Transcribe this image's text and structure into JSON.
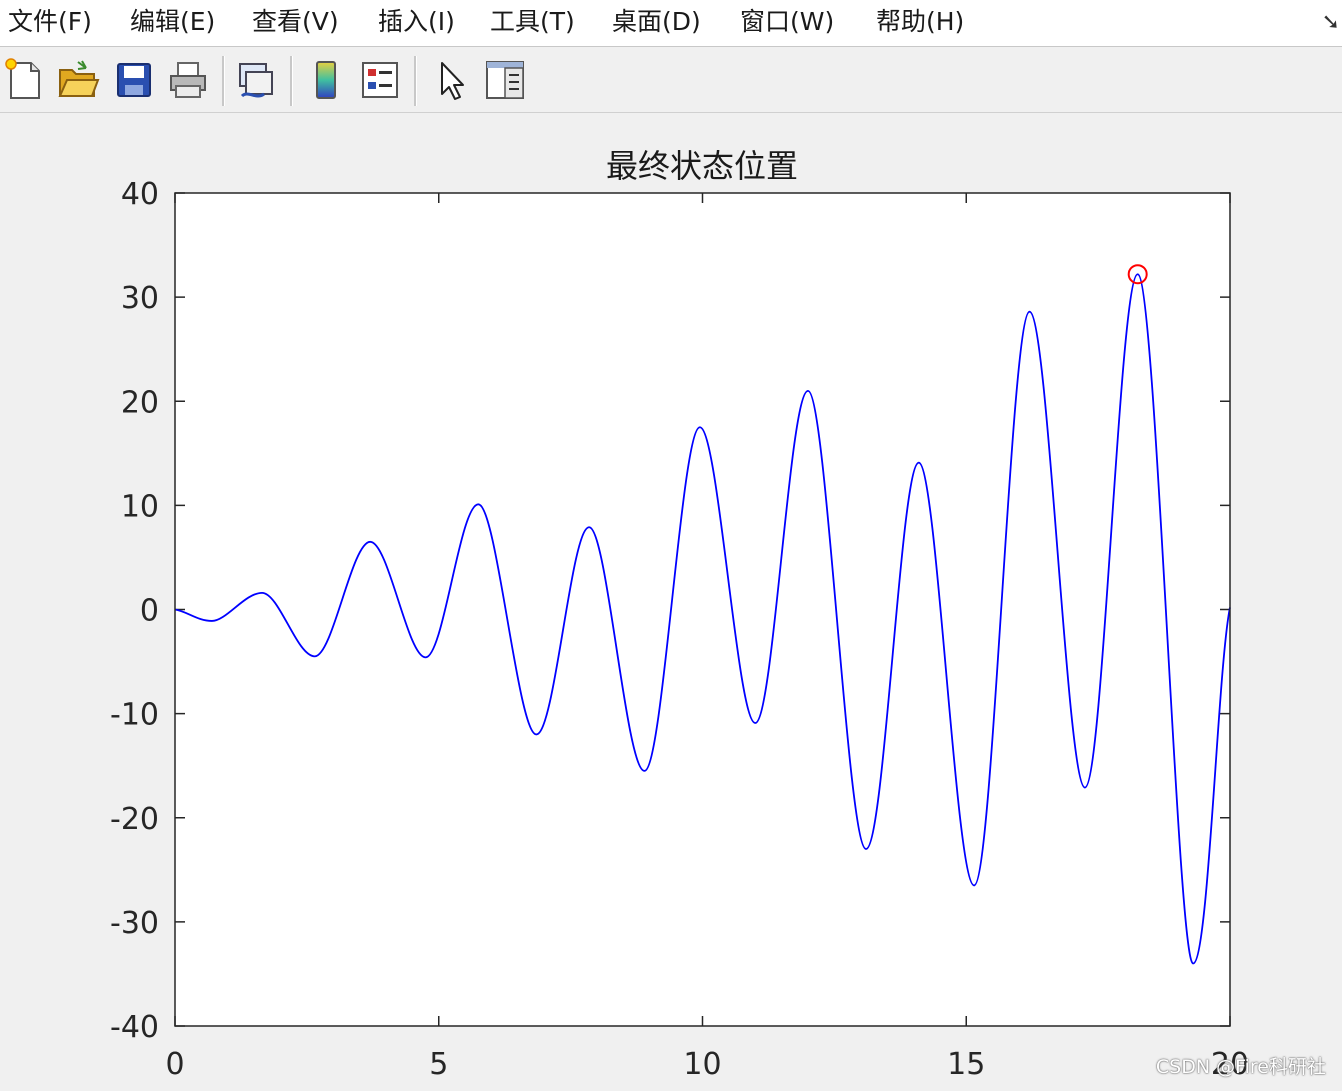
{
  "menu": {
    "items": [
      {
        "id": "file",
        "label": "文件(F)"
      },
      {
        "id": "edit",
        "label": "编辑(E)"
      },
      {
        "id": "view",
        "label": "查看(V)"
      },
      {
        "id": "insert",
        "label": "插入(I)"
      },
      {
        "id": "tools",
        "label": "工具(T)"
      },
      {
        "id": "desktop",
        "label": "桌面(D)"
      },
      {
        "id": "window",
        "label": "窗口(W)"
      },
      {
        "id": "help",
        "label": "帮助(H)"
      }
    ]
  },
  "toolbar": {
    "buttons": [
      {
        "id": "new",
        "icon": "new-figure-icon"
      },
      {
        "id": "open",
        "icon": "open-folder-icon"
      },
      {
        "id": "save",
        "icon": "save-icon"
      },
      {
        "id": "print",
        "icon": "print-icon"
      },
      {
        "id": "link",
        "icon": "link-plot-icon"
      },
      {
        "id": "colorbar",
        "icon": "colorbar-icon"
      },
      {
        "id": "legend",
        "icon": "legend-icon"
      },
      {
        "id": "edit-plot",
        "icon": "pointer-arrow-icon"
      },
      {
        "id": "property-editor",
        "icon": "property-editor-icon"
      }
    ]
  },
  "colors": {
    "line": "#0000ff",
    "marker": "#ff0000",
    "axes_bg": "#ffffff",
    "figure_bg": "#f0f0f0",
    "axis": "#262626"
  },
  "chart_data": {
    "type": "line",
    "title": "最终状态位置",
    "xlabel": "",
    "ylabel": "",
    "xlim": [
      0,
      20
    ],
    "ylim": [
      -40,
      40
    ],
    "xticks": [
      0,
      5,
      10,
      15,
      20
    ],
    "yticks": [
      -40,
      -30,
      -20,
      -10,
      0,
      10,
      20,
      30,
      40
    ],
    "grid": false,
    "series": [
      {
        "x": [
          0,
          0.7,
          1.65,
          2.65,
          3.7,
          4.75,
          5.75,
          6.85,
          7.85,
          8.9,
          9.95,
          11.0,
          12.0,
          13.1,
          14.1,
          15.15,
          16.2,
          17.25,
          18.25,
          19.3,
          20
        ],
        "y": [
          0,
          -1.1,
          1.6,
          -4.5,
          6.5,
          -4.6,
          10.1,
          -12.0,
          7.9,
          -15.5,
          17.5,
          -10.9,
          21.0,
          -23.0,
          14.1,
          -26.5,
          28.6,
          -17.1,
          32.2,
          -34.0,
          0.2
        ]
      }
    ],
    "markers": [
      {
        "x": 18.25,
        "y": 32.2,
        "shape": "circle"
      }
    ]
  },
  "watermark": "CSDN @Fire科研社"
}
